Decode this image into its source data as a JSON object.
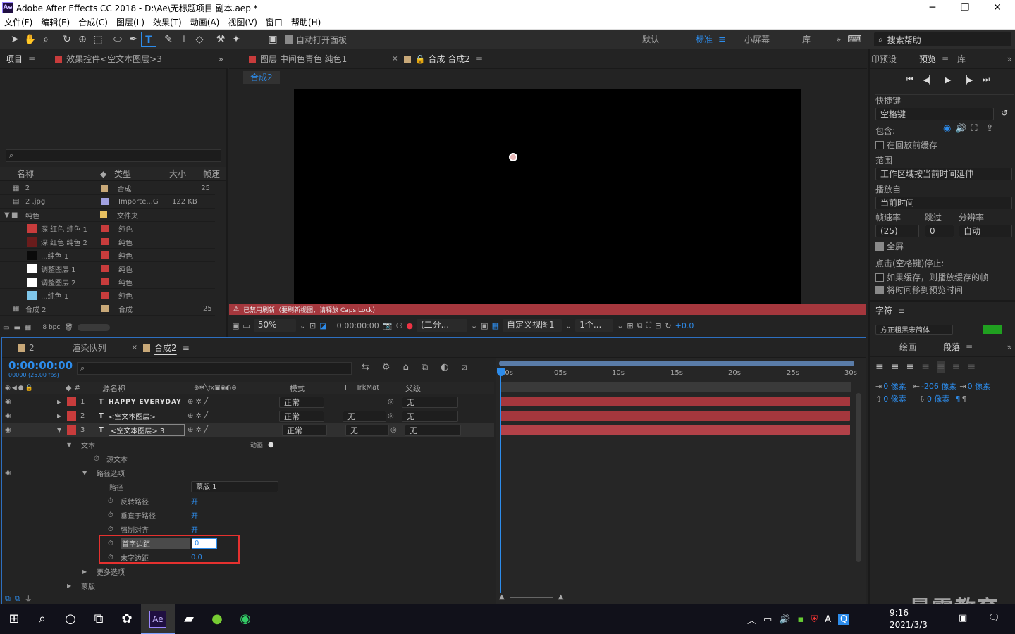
{
  "window": {
    "title": "Adobe After Effects CC 2018 - D:\\Ae\\无标题项目 副本.aep *",
    "app_badge": "Ae"
  },
  "menu": [
    "文件(F)",
    "编辑(E)",
    "合成(C)",
    "图层(L)",
    "效果(T)",
    "动画(A)",
    "视图(V)",
    "窗口",
    "帮助(H)"
  ],
  "toolbar": {
    "auto_open": "自动打开面板",
    "workspaces": [
      "默认",
      "标准",
      "小屏幕",
      "库"
    ],
    "active_workspace": "标准",
    "search_help": "搜索帮助"
  },
  "project_panel": {
    "tabs": [
      "项目",
      "效果控件<空文本图层>3"
    ],
    "columns": [
      "名称",
      "类型",
      "大小",
      "帧速"
    ],
    "items": [
      {
        "name": "2",
        "type": "合成",
        "size": "",
        "fps": "25",
        "color": "#c8a878"
      },
      {
        "name": "2 .jpg",
        "type": "Importe...G",
        "size": "122 KB",
        "fps": "",
        "color": "#a0a0e0"
      },
      {
        "name": "纯色",
        "type": "文件夹",
        "size": "",
        "fps": "",
        "color": "#e8c060"
      },
      {
        "name": "深 红色 纯色 1",
        "type": "纯色",
        "size": "",
        "fps": "",
        "color": "#c83c3c"
      },
      {
        "name": "深 红色 纯色 2",
        "type": "纯色",
        "size": "",
        "fps": "",
        "color": "#c83c3c"
      },
      {
        "name": "...纯色 1",
        "type": "纯色",
        "size": "",
        "fps": "",
        "color": "#c83c3c"
      },
      {
        "name": "调整图层 1",
        "type": "纯色",
        "size": "",
        "fps": "",
        "color": "#c83c3c"
      },
      {
        "name": "调整图层 2",
        "type": "纯色",
        "size": "",
        "fps": "",
        "color": "#c83c3c"
      },
      {
        "name": "...纯色 1",
        "type": "纯色",
        "size": "",
        "fps": "",
        "color": "#c83c3c"
      },
      {
        "name": "合成 2",
        "type": "合成",
        "size": "",
        "fps": "25",
        "color": "#c8a878"
      }
    ],
    "bpc": "8 bpc"
  },
  "viewer": {
    "tabs": [
      "图层 中间色青色 纯色1",
      "合成 合成2"
    ],
    "comp_chip": "合成2",
    "warning": "已禁用刷新（要刷新视图，请释放 Caps Lock）",
    "zoom": "50%",
    "timecode": "0:00:00:00",
    "resolution": "(二分...",
    "view": "自定义视图1",
    "views_count": "1个...",
    "exposure": "+0.0"
  },
  "preview_panel": {
    "tabs": [
      "印预设",
      "预览",
      "库"
    ],
    "shortcut_label": "快捷键",
    "shortcut": "空格键",
    "include_label": "包含:",
    "cache_before": "在回放前缓存",
    "range_label": "范围",
    "range": "工作区域按当前时间延伸",
    "play_from_label": "播放自",
    "play_from": "当前时间",
    "fps_label": "帧速率",
    "skip_label": "跳过",
    "res_label": "分辨率",
    "fps": "(25)",
    "skip": "0",
    "res": "自动",
    "fullscreen": "全屏",
    "stop_label": "点击(空格键)停止:",
    "opt1": "如果缓存，则播放缓存的帧",
    "opt2": "将时间移到预览时间",
    "char_tab": "字符",
    "font": "方正粗黑宋简体"
  },
  "paragraph_panel": {
    "tabs": [
      "绘画",
      "段落"
    ],
    "v1": "0 像素",
    "v2": "-206 像素",
    "v3": "0 像素",
    "v4": "0 像素",
    "v5": "0 像素"
  },
  "timeline": {
    "tabs": [
      "2",
      "渲染队列",
      "合成2"
    ],
    "timecode": "0:00:00:00",
    "frames": "00000 (25.00 fps)",
    "col_source": "源名称",
    "col_mode": "模式",
    "col_t": "T",
    "col_trk": "TrkMat",
    "col_parent": "父级",
    "ruler": [
      "00s",
      "05s",
      "10s",
      "15s",
      "20s",
      "25s",
      "30s"
    ],
    "layers": [
      {
        "num": "1",
        "name": "HAPPY EVERYDAY",
        "mode": "正常",
        "trk": "",
        "parent": "无"
      },
      {
        "num": "2",
        "name": "<空文本图层>",
        "mode": "正常",
        "trk": "无",
        "parent": "无"
      },
      {
        "num": "3",
        "name": "<空文本图层> 3",
        "mode": "正常",
        "trk": "无",
        "parent": "无"
      }
    ],
    "props": {
      "text": "文本",
      "animate": "动画:",
      "source_text": "源文本",
      "path_options": "路径选项",
      "path": "路径",
      "path_value": "蒙版 1",
      "reverse": "反转路径",
      "reverse_v": "开",
      "perp": "垂直于路径",
      "perp_v": "开",
      "force": "强制对齐",
      "force_v": "开",
      "first": "首字边距",
      "first_v": "0",
      "last": "末字边距",
      "last_v": "0.0",
      "more": "更多选项",
      "masks": "蒙版"
    }
  },
  "taskbar": {
    "time": "9:16",
    "date": "2021/3/3",
    "watermark": "最需教育"
  },
  "colors": {
    "accent": "#2d8ceb",
    "layer_bar": "#a5373d",
    "warning": "#a5373d",
    "highlight": "#e5312f"
  }
}
